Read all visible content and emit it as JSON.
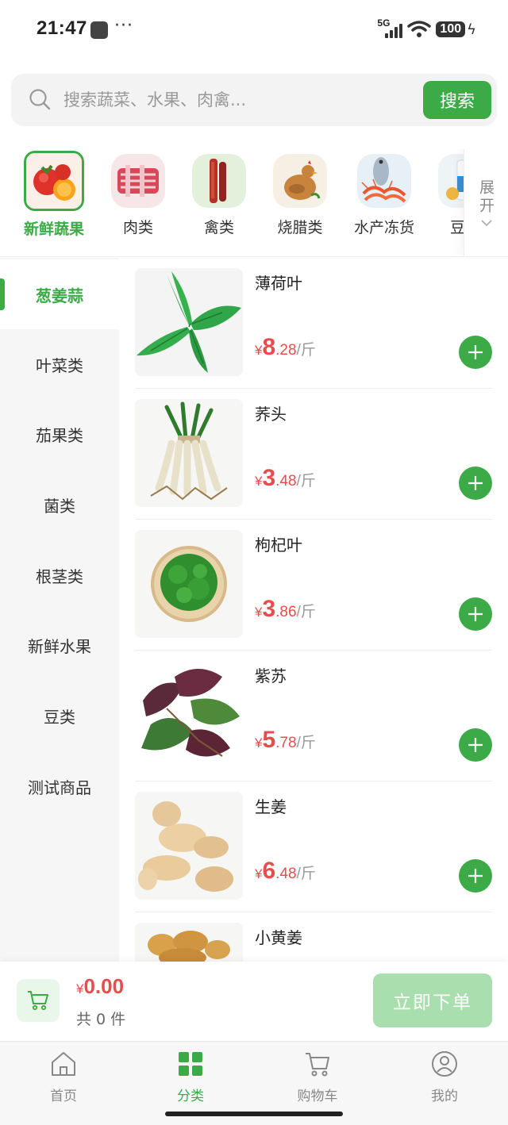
{
  "status_bar": {
    "time": "21:47",
    "dots": "···",
    "network": "5G",
    "battery": "100"
  },
  "search": {
    "placeholder": "搜索蔬菜、水果、肉禽...",
    "button_label": "搜索"
  },
  "categories": [
    {
      "label": "新鲜蔬果",
      "icon": "vegetables-fruits-icon",
      "active": true
    },
    {
      "label": "肉类",
      "icon": "meat-icon"
    },
    {
      "label": "禽类",
      "icon": "poultry-icon"
    },
    {
      "label": "烧腊类",
      "icon": "roast-meat-icon"
    },
    {
      "label": "水产冻货",
      "icon": "seafood-icon"
    },
    {
      "label": "豆品",
      "icon": "bean-products-icon"
    }
  ],
  "expand_label": "展开",
  "sidebar": {
    "items": [
      {
        "label": "葱姜蒜",
        "active": true
      },
      {
        "label": "叶菜类"
      },
      {
        "label": "茄果类"
      },
      {
        "label": "菌类"
      },
      {
        "label": "根茎类"
      },
      {
        "label": "新鲜水果"
      },
      {
        "label": "豆类"
      },
      {
        "label": "测试商品"
      }
    ]
  },
  "products": [
    {
      "name": "薄荷叶",
      "currency": "¥",
      "price_int": "8",
      "price_dec": ".28",
      "unit": "/斤",
      "image": "mint-leaves"
    },
    {
      "name": "荞头",
      "currency": "¥",
      "price_int": "3",
      "price_dec": ".48",
      "unit": "/斤",
      "image": "scallion-bulbs"
    },
    {
      "name": "枸杞叶",
      "currency": "¥",
      "price_int": "3",
      "price_dec": ".86",
      "unit": "/斤",
      "image": "goji-leaves"
    },
    {
      "name": "紫苏",
      "currency": "¥",
      "price_int": "5",
      "price_dec": ".78",
      "unit": "/斤",
      "image": "perilla"
    },
    {
      "name": "生姜",
      "currency": "¥",
      "price_int": "6",
      "price_dec": ".48",
      "unit": "/斤",
      "image": "ginger"
    },
    {
      "name": "小黄姜",
      "image": "small-yellow-ginger"
    }
  ],
  "cart": {
    "currency": "¥",
    "total": "0.00",
    "count_text": "共 0 件",
    "order_button": "立即下单"
  },
  "tabs": [
    {
      "label": "首页",
      "icon": "home-icon"
    },
    {
      "label": "分类",
      "icon": "category-grid-icon",
      "active": true
    },
    {
      "label": "购物车",
      "icon": "cart-icon"
    },
    {
      "label": "我的",
      "icon": "profile-icon"
    }
  ],
  "colors": {
    "accent": "#3cab47",
    "price": "#e94c4c",
    "order_button_disabled": "#a9dfae"
  }
}
